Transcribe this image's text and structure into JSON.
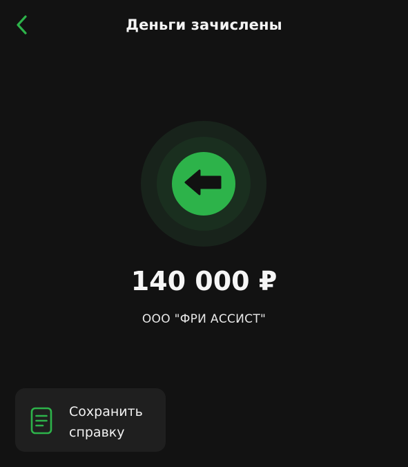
{
  "header": {
    "title": "Деньги зачислены",
    "back_icon": "chevron-left-icon"
  },
  "status": {
    "icon": "arrow-left-icon",
    "accent_color": "#2DB34A"
  },
  "transfer": {
    "amount": "140 000 ₽",
    "payer": "ООО \"ФРИ АССИСТ\""
  },
  "actions": {
    "save_certificate_line1": "Сохранить",
    "save_certificate_line2": "справку",
    "save_icon": "document-icon"
  }
}
